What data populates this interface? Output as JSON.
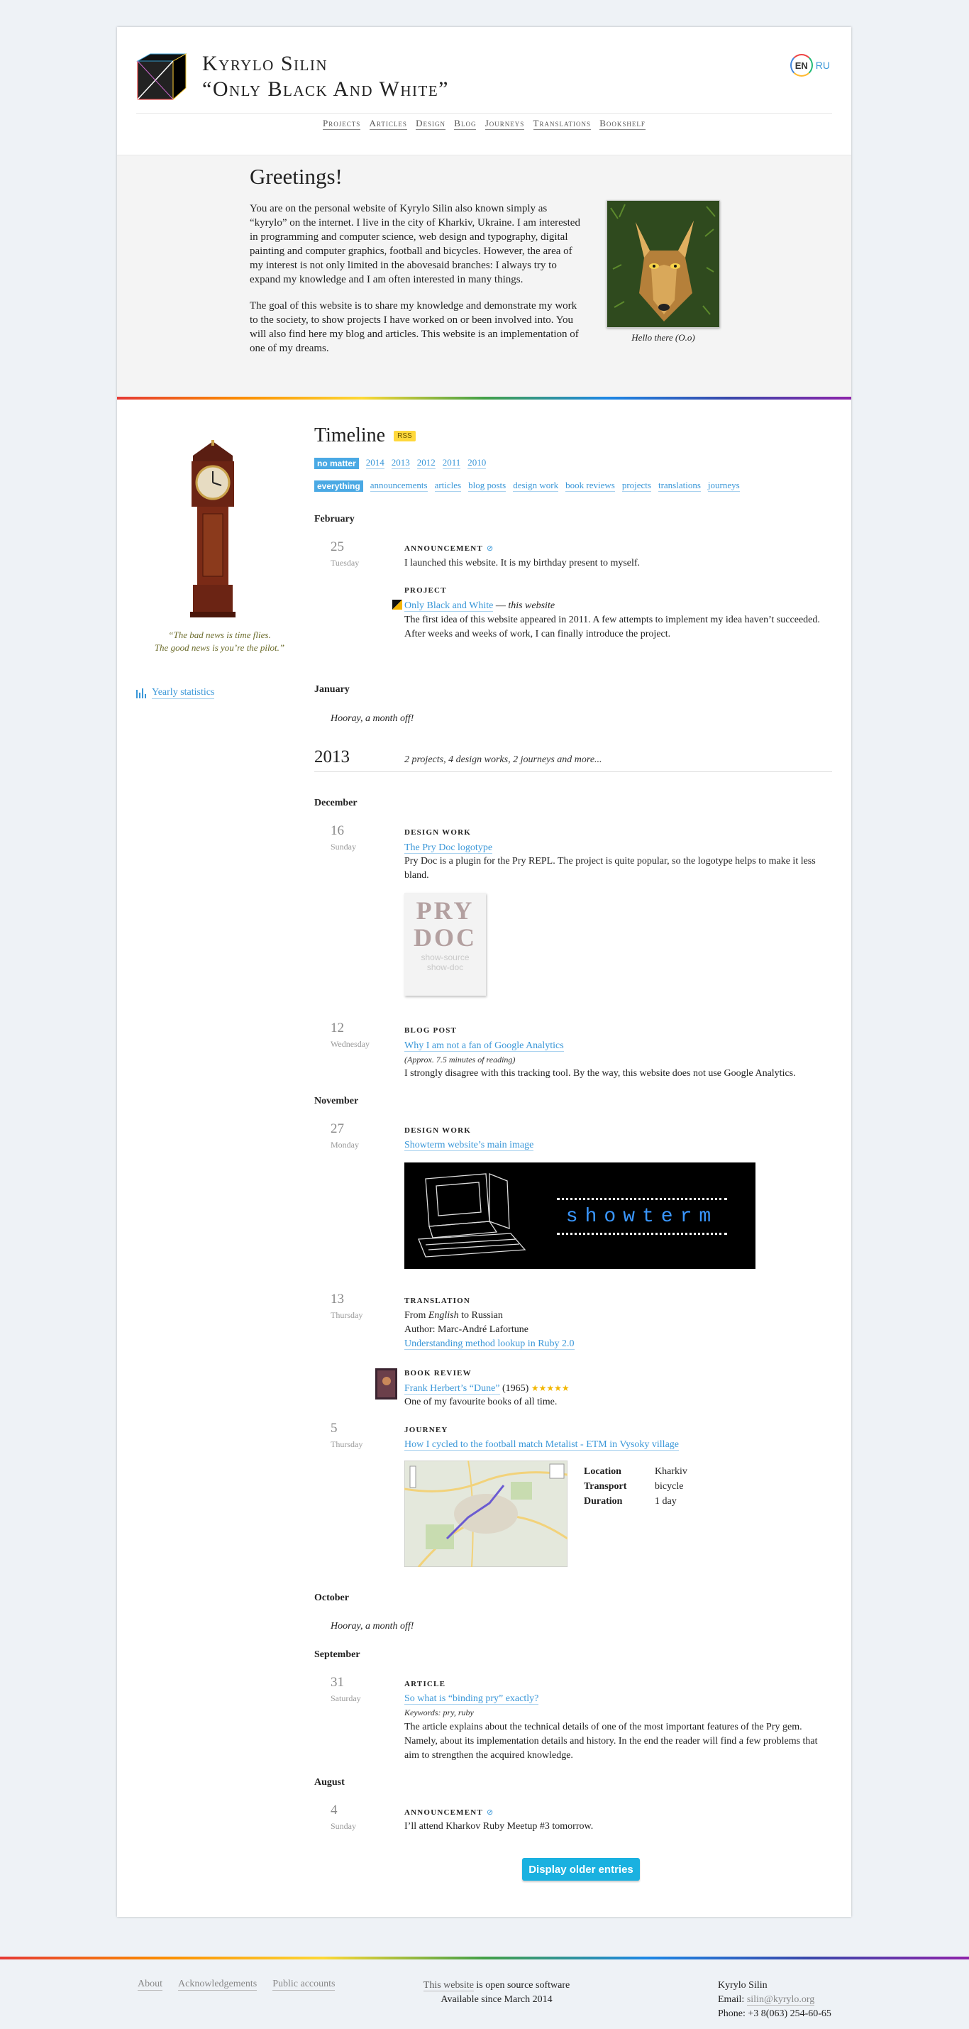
{
  "header": {
    "title_line1": "Kyrylo Silin",
    "title_line2": "“Only Black And White”",
    "lang_en": "EN",
    "lang_ru": "RU",
    "nav": [
      "Projects",
      "Articles",
      "Design",
      "Blog",
      "Journeys",
      "Translations",
      "Bookshelf"
    ]
  },
  "greeting": {
    "title": "Greetings!",
    "p1": "You are on the personal website of Kyrylo Silin also known simply as “kyrylo” on the internet. I live in the city of Kharkiv, Ukraine. I am interested in programming and computer science, web design and typography, digital painting and computer graphics, football and bicycles. However, the area of my interest is not only limited in the abovesaid branches: I always try to expand my knowledge and I am often interested in many things.",
    "p2": "The goal of this website is to share my knowledge and demonstrate my work to the society, to show projects I have worked on or been involved into. You will also find here my blog and articles. This website is an implementation of one of my dreams.",
    "image_caption": "Hello there (O.o)"
  },
  "sidebar": {
    "quote_line1": "“The bad news is time flies.",
    "quote_line2": "The good news is you’re the pilot.”",
    "stats_link": "Yearly statistics"
  },
  "timeline": {
    "title": "Timeline",
    "rss": "RSS",
    "years": [
      "no matter",
      "2014",
      "2013",
      "2012",
      "2011",
      "2010"
    ],
    "kinds": [
      "everything",
      "announcements",
      "articles",
      "blog posts",
      "design work",
      "book reviews",
      "projects",
      "translations",
      "journeys"
    ],
    "feb": "February",
    "e1": {
      "day": "25",
      "weekday": "Tuesday",
      "kind": "Announcement",
      "text": "I launched this website. It is my birthday present to myself."
    },
    "e2": {
      "kind": "Project",
      "link": "Only Black and White",
      "dash": " — ",
      "desc": "this website",
      "text": "The first idea of this website appeared in 2011. A few attempts to implement my idea haven’t succeeded. After weeks and weeks of work, I can finally introduce the project."
    },
    "jan": "January",
    "hooray": "Hooray, a month off!",
    "year2013": "2013",
    "year2013_summary": "2 projects, 4 design works, 2 journeys and more...",
    "dec": "December",
    "e3": {
      "day": "16",
      "weekday": "Sunday",
      "kind": "Design work",
      "link": "The Pry Doc logotype",
      "text": "Pry Doc is a plugin for the Pry REPL. The project is quite popular, so the logotype helps to make it less bland.",
      "logo1": "PRY",
      "logo2": "DOC",
      "logo3": "show-source",
      "logo4": "show-doc"
    },
    "e4": {
      "day": "12",
      "weekday": "Wednesday",
      "kind": "Blog post",
      "link": "Why I am not a fan of Google Analytics",
      "note": "(Approx. 7.5 minutes of reading)",
      "text": "I strongly disagree with this tracking tool. By the way, this website does not use Google Analytics."
    },
    "nov": "November",
    "e5": {
      "day": "27",
      "weekday": "Monday",
      "kind": "Design work",
      "link": "Showterm website’s main image",
      "banner": "showterm"
    },
    "e6": {
      "day": "13",
      "weekday": "Thursday",
      "kind": "Translation",
      "from": "From ",
      "lang1": "English",
      "to": " to Russian",
      "author": "Author: Marc-André Lafortune",
      "link": "Understanding method lookup in Ruby 2.0"
    },
    "e7": {
      "kind": "Book review",
      "link": "Frank Herbert’s “Dune”",
      "year": " (1965) ",
      "stars": "★★★★★",
      "text": "One of my favourite books of all time."
    },
    "e8": {
      "day": "5",
      "weekday": "Thursday",
      "kind": "Journey",
      "link": "How I cycled to the football match Metalist - ETM in Vysoky village",
      "loc_k": "Location",
      "loc_v": "Kharkiv",
      "tr_k": "Transport",
      "tr_v": "bicycle",
      "du_k": "Duration",
      "du_v": "1 day"
    },
    "oct": "October",
    "hooray2": "Hooray, a month off!",
    "sep": "September",
    "e9": {
      "day": "31",
      "weekday": "Saturday",
      "kind": "Article",
      "link": "So what is “binding pry” exactly?",
      "keywords": "Keywords: pry, ruby",
      "text": "The article explains about the technical details of one of the most important features of the Pry gem. Namely, about its implementation details and history. In the end the reader will find a few problems that aim to strengthen the acquired knowledge."
    },
    "aug": "August",
    "e10": {
      "day": "4",
      "weekday": "Sunday",
      "kind": "Announcement",
      "text": "I’ll attend Kharkov Ruby Meetup #3 tomorrow."
    },
    "older_button": "Display older entries"
  },
  "footer": {
    "about": "About",
    "ack": "Acknowledgements",
    "public": "Public accounts",
    "src_link": "This website",
    "src_text": " is open source software",
    "since": "Available since March 2014",
    "name": "Kyrylo Silin",
    "email_label": "Email: ",
    "email": "silin@kyrylo.org",
    "phone": "Phone: +3 8(063) 254-60-65"
  },
  "colors": {
    "accent": "#3a97d8",
    "rss": "#ffd83b",
    "button": "#1ab1e0"
  }
}
